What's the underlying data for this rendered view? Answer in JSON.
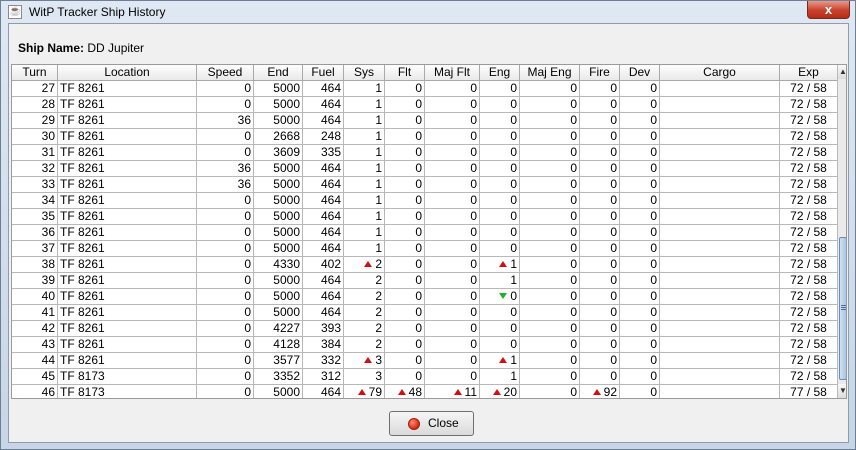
{
  "window": {
    "title": "WitP Tracker Ship History",
    "close_glyph": "x"
  },
  "ship": {
    "label": "Ship Name:",
    "name": "DD Jupiter"
  },
  "table": {
    "columns": [
      "Turn",
      "Location",
      "Speed",
      "End",
      "Fuel",
      "Sys",
      "Flt",
      "Maj Flt",
      "Eng",
      "Maj Eng",
      "Fire",
      "Dev",
      "Cargo",
      "Exp"
    ],
    "rows": [
      {
        "turn": "27",
        "loc": "TF 8261",
        "speed": "0",
        "end": "5000",
        "fuel": "464",
        "sys": "1",
        "flt": "0",
        "majflt": "0",
        "eng": "0",
        "majeng": "0",
        "fire": "0",
        "dev": "0",
        "cargo": "",
        "exp": "72 / 58"
      },
      {
        "turn": "28",
        "loc": "TF 8261",
        "speed": "0",
        "end": "5000",
        "fuel": "464",
        "sys": "1",
        "flt": "0",
        "majflt": "0",
        "eng": "0",
        "majeng": "0",
        "fire": "0",
        "dev": "0",
        "cargo": "",
        "exp": "72 / 58"
      },
      {
        "turn": "29",
        "loc": "TF 8261",
        "speed": "36",
        "end": "5000",
        "fuel": "464",
        "sys": "1",
        "flt": "0",
        "majflt": "0",
        "eng": "0",
        "majeng": "0",
        "fire": "0",
        "dev": "0",
        "cargo": "",
        "exp": "72 / 58"
      },
      {
        "turn": "30",
        "loc": "TF 8261",
        "speed": "0",
        "end": "2668",
        "fuel": "248",
        "sys": "1",
        "flt": "0",
        "majflt": "0",
        "eng": "0",
        "majeng": "0",
        "fire": "0",
        "dev": "0",
        "cargo": "",
        "exp": "72 / 58"
      },
      {
        "turn": "31",
        "loc": "TF 8261",
        "speed": "0",
        "end": "3609",
        "fuel": "335",
        "sys": "1",
        "flt": "0",
        "majflt": "0",
        "eng": "0",
        "majeng": "0",
        "fire": "0",
        "dev": "0",
        "cargo": "",
        "exp": "72 / 58"
      },
      {
        "turn": "32",
        "loc": "TF 8261",
        "speed": "36",
        "end": "5000",
        "fuel": "464",
        "sys": "1",
        "flt": "0",
        "majflt": "0",
        "eng": "0",
        "majeng": "0",
        "fire": "0",
        "dev": "0",
        "cargo": "",
        "exp": "72 / 58"
      },
      {
        "turn": "33",
        "loc": "TF 8261",
        "speed": "36",
        "end": "5000",
        "fuel": "464",
        "sys": "1",
        "flt": "0",
        "majflt": "0",
        "eng": "0",
        "majeng": "0",
        "fire": "0",
        "dev": "0",
        "cargo": "",
        "exp": "72 / 58"
      },
      {
        "turn": "34",
        "loc": "TF 8261",
        "speed": "0",
        "end": "5000",
        "fuel": "464",
        "sys": "1",
        "flt": "0",
        "majflt": "0",
        "eng": "0",
        "majeng": "0",
        "fire": "0",
        "dev": "0",
        "cargo": "",
        "exp": "72 / 58"
      },
      {
        "turn": "35",
        "loc": "TF 8261",
        "speed": "0",
        "end": "5000",
        "fuel": "464",
        "sys": "1",
        "flt": "0",
        "majflt": "0",
        "eng": "0",
        "majeng": "0",
        "fire": "0",
        "dev": "0",
        "cargo": "",
        "exp": "72 / 58"
      },
      {
        "turn": "36",
        "loc": "TF 8261",
        "speed": "0",
        "end": "5000",
        "fuel": "464",
        "sys": "1",
        "flt": "0",
        "majflt": "0",
        "eng": "0",
        "majeng": "0",
        "fire": "0",
        "dev": "0",
        "cargo": "",
        "exp": "72 / 58"
      },
      {
        "turn": "37",
        "loc": "TF 8261",
        "speed": "0",
        "end": "5000",
        "fuel": "464",
        "sys": "1",
        "flt": "0",
        "majflt": "0",
        "eng": "0",
        "majeng": "0",
        "fire": "0",
        "dev": "0",
        "cargo": "",
        "exp": "72 / 58"
      },
      {
        "turn": "38",
        "loc": "TF 8261",
        "speed": "0",
        "end": "4330",
        "fuel": "402",
        "sys": "2",
        "sys_ind": "up",
        "flt": "0",
        "majflt": "0",
        "eng": "1",
        "eng_ind": "up",
        "majeng": "0",
        "fire": "0",
        "dev": "0",
        "cargo": "",
        "exp": "72 / 58"
      },
      {
        "turn": "39",
        "loc": "TF 8261",
        "speed": "0",
        "end": "5000",
        "fuel": "464",
        "sys": "2",
        "flt": "0",
        "majflt": "0",
        "eng": "1",
        "majeng": "0",
        "fire": "0",
        "dev": "0",
        "cargo": "",
        "exp": "72 / 58"
      },
      {
        "turn": "40",
        "loc": "TF 8261",
        "speed": "0",
        "end": "5000",
        "fuel": "464",
        "sys": "2",
        "flt": "0",
        "majflt": "0",
        "eng": "0",
        "eng_ind": "down",
        "majeng": "0",
        "fire": "0",
        "dev": "0",
        "cargo": "",
        "exp": "72 / 58"
      },
      {
        "turn": "41",
        "loc": "TF 8261",
        "speed": "0",
        "end": "5000",
        "fuel": "464",
        "sys": "2",
        "flt": "0",
        "majflt": "0",
        "eng": "0",
        "majeng": "0",
        "fire": "0",
        "dev": "0",
        "cargo": "",
        "exp": "72 / 58"
      },
      {
        "turn": "42",
        "loc": "TF 8261",
        "speed": "0",
        "end": "4227",
        "fuel": "393",
        "sys": "2",
        "flt": "0",
        "majflt": "0",
        "eng": "0",
        "majeng": "0",
        "fire": "0",
        "dev": "0",
        "cargo": "",
        "exp": "72 / 58"
      },
      {
        "turn": "43",
        "loc": "TF 8261",
        "speed": "0",
        "end": "4128",
        "fuel": "384",
        "sys": "2",
        "flt": "0",
        "majflt": "0",
        "eng": "0",
        "majeng": "0",
        "fire": "0",
        "dev": "0",
        "cargo": "",
        "exp": "72 / 58"
      },
      {
        "turn": "44",
        "loc": "TF 8261",
        "speed": "0",
        "end": "3577",
        "fuel": "332",
        "sys": "3",
        "sys_ind": "up",
        "flt": "0",
        "majflt": "0",
        "eng": "1",
        "eng_ind": "up",
        "majeng": "0",
        "fire": "0",
        "dev": "0",
        "cargo": "",
        "exp": "72 / 58"
      },
      {
        "turn": "45",
        "loc": "TF 8173",
        "speed": "0",
        "end": "3352",
        "fuel": "312",
        "sys": "3",
        "flt": "0",
        "majflt": "0",
        "eng": "1",
        "majeng": "0",
        "fire": "0",
        "dev": "0",
        "cargo": "",
        "exp": "72 / 58"
      },
      {
        "turn": "46",
        "loc": "TF 8173",
        "speed": "0",
        "end": "5000",
        "fuel": "464",
        "sys": "79",
        "sys_ind": "up",
        "flt": "48",
        "flt_ind": "up",
        "majflt": "11",
        "majflt_ind": "up",
        "eng": "20",
        "eng_ind": "up",
        "majeng": "0",
        "fire": "92",
        "fire_ind": "up",
        "dev": "0",
        "cargo": "",
        "exp": "77 / 58"
      }
    ]
  },
  "scrollbar": {
    "up_glyph": "▲",
    "down_glyph": "▼"
  },
  "buttons": {
    "close_label": "Close"
  },
  "colors": {
    "indicator_up": "#d01010",
    "indicator_down": "#22b022",
    "close_button_dot": "#d42a10"
  }
}
